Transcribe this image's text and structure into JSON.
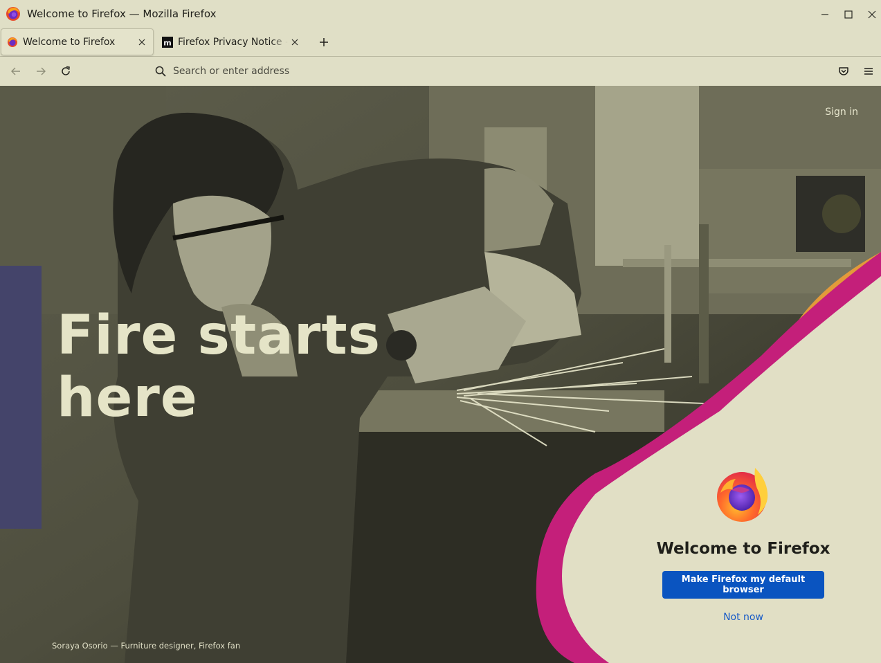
{
  "window": {
    "title": "Welcome to Firefox — Mozilla Firefox",
    "app_icon": "firefox-logo-icon",
    "controls": [
      "minimize-icon",
      "maximize-icon",
      "close-icon"
    ]
  },
  "tabs": [
    {
      "label": "Welcome to Firefox",
      "favicon": "firefox-logo-icon",
      "active": true
    },
    {
      "label": "Firefox Privacy Notice — Mozilla",
      "favicon": "mozilla-m-icon",
      "active": false
    }
  ],
  "toolbar": {
    "new_tab_icon": "plus-icon",
    "back_icon": "arrow-left-icon",
    "forward_icon": "arrow-right-icon",
    "reload_icon": "reload-icon",
    "pocket_icon": "pocket-icon",
    "menu_icon": "hamburger-menu-icon"
  },
  "address_bar": {
    "placeholder": "Search or enter address",
    "value": ""
  },
  "page": {
    "sign_in": "Sign in",
    "hero_line1": "Fire starts",
    "hero_line2": "here",
    "photo_credit": "Soraya Osorio — Furniture designer, Firefox fan",
    "welcome_title": "Welcome to Firefox",
    "primary_button": "Make Firefox my default browser",
    "secondary_link": "Not now"
  },
  "colors": {
    "chrome_bg": "#e0dfc6",
    "primary_button": "#0a54c0",
    "link": "#1559c7",
    "accent_magenta": "#c41f7a",
    "accent_orange": "#e39a3a",
    "card_bg": "#e1dfc5"
  }
}
